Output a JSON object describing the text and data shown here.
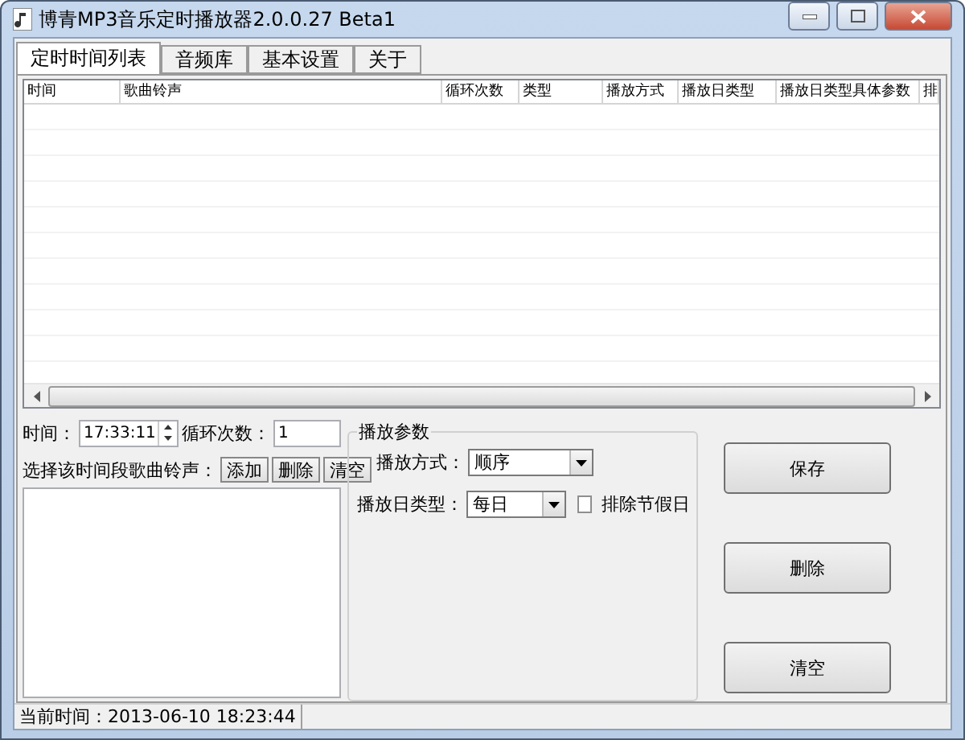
{
  "window": {
    "title": "博青MP3音乐定时播放器2.0.0.27 Beta1"
  },
  "tabs": [
    {
      "label": "定时时间列表",
      "selected": true
    },
    {
      "label": "音频库",
      "selected": false
    },
    {
      "label": "基本设置",
      "selected": false
    },
    {
      "label": "关于",
      "selected": false
    }
  ],
  "table": {
    "columns": [
      "时间",
      "歌曲铃声",
      "循环次数",
      "类型",
      "播放方式",
      "播放日类型",
      "播放日类型具体参数",
      "排"
    ]
  },
  "time": {
    "label": "时间：",
    "value": "17:33:11"
  },
  "loop": {
    "label": "循环次数：",
    "value": "1"
  },
  "song_select": {
    "label": "选择该时间段歌曲铃声：",
    "buttons": [
      "添加",
      "删除",
      "清空"
    ]
  },
  "play_params": {
    "title": "播放参数",
    "mode": {
      "label": "播放方式：",
      "value": "顺序"
    },
    "day_type": {
      "label": "播放日类型：",
      "value": "每日"
    },
    "exclude_holidays": {
      "label": "排除节假日",
      "checked": false
    }
  },
  "actions": [
    "保存",
    "删除",
    "清空"
  ],
  "status_bar": "当前时间：2013-06-10 18:23:44"
}
